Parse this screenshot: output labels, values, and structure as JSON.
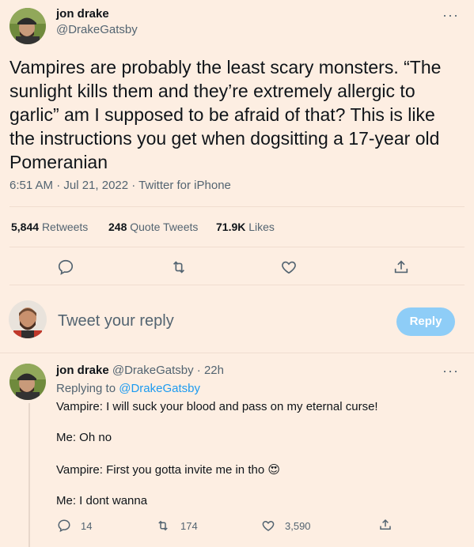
{
  "main_tweet": {
    "author_name": "jon drake",
    "author_handle": "@DrakeGatsby",
    "text": "Vampires are probably the least scary monsters. “The sunlight kills them and they’re extremely allergic to garlic” am I supposed to be afraid of that? This is like the instructions you get when dogsitting a 17-year old Pomeranian",
    "timestamp": "6:51 AM · Jul 21, 2022 · Twitter for iPhone",
    "retweets_count": "5,844",
    "retweets_label": "Retweets",
    "quote_count": "248",
    "quote_label": "Quote Tweets",
    "likes_count": "71.9K",
    "likes_label": "Likes"
  },
  "composer": {
    "placeholder": "Tweet your reply",
    "button_label": "Reply"
  },
  "reply_tweet": {
    "author_name": "jon drake",
    "author_handle_time": "@DrakeGatsby · 22h",
    "replying_to_label": "Replying to",
    "replying_to_handle": "@DrakeGatsby",
    "lines": [
      "Vampire: I will suck your blood and pass on my eternal curse!",
      "Me: Oh no",
      "Vampire: First you gotta invite me in tho",
      "Me: I dont wanna"
    ],
    "emoji": "😍",
    "reply_count": "14",
    "retweet_count": "174",
    "like_count": "3,590"
  },
  "colors": {
    "background": "#fdeee2",
    "accent": "#1d9bf0",
    "reply_button": "#8ecdf7",
    "secondary_text": "#536471"
  }
}
